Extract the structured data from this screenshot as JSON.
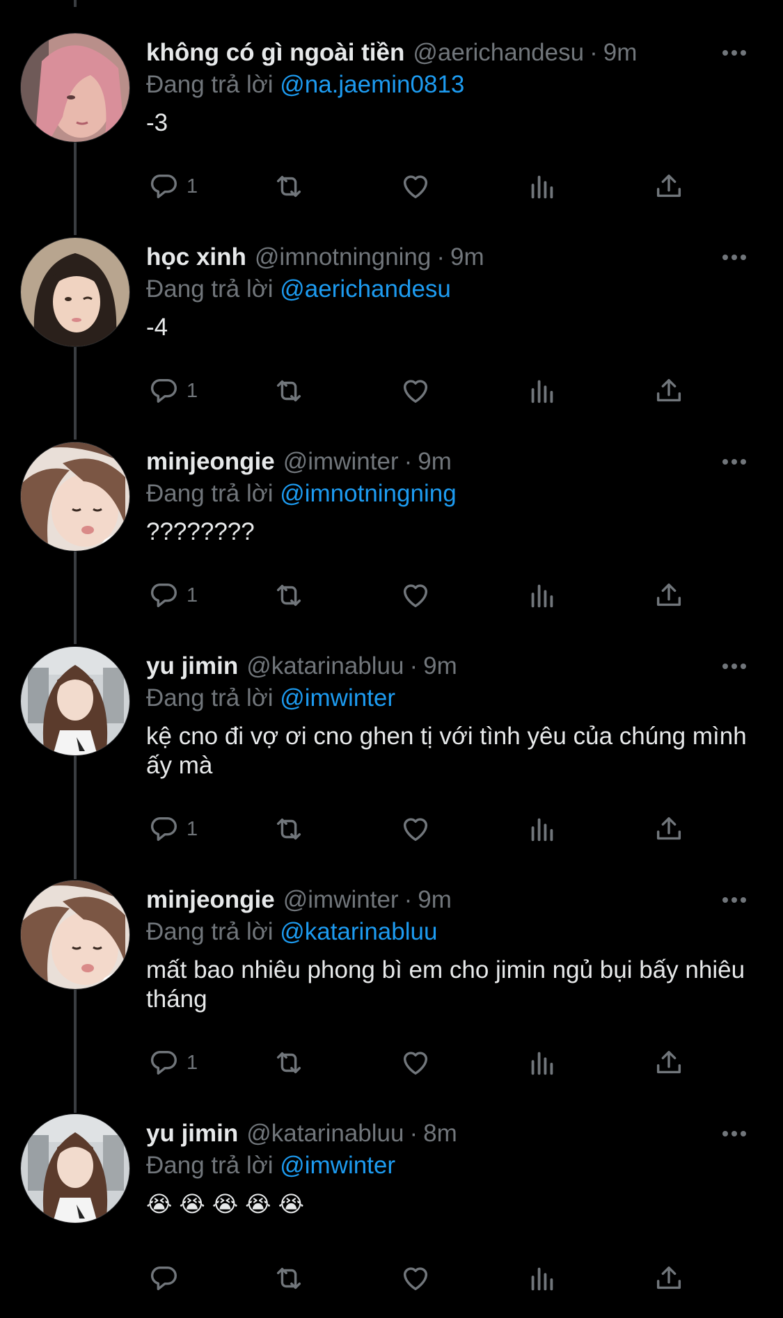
{
  "tweets": [
    {
      "name": "không có gì ngoài tiền",
      "handle": "@aerichandesu",
      "time": "9m",
      "reply_prefix": "Đang trả lời",
      "reply_to": "@na.jaemin0813",
      "text": "-3",
      "reply_count": "1",
      "avatar_icon": "avatar-pink-hair"
    },
    {
      "name": "học xinh",
      "handle": "@imnotningning",
      "time": "9m",
      "reply_prefix": "Đang trả lời",
      "reply_to": "@aerichandesu",
      "text": "-4",
      "reply_count": "1",
      "avatar_icon": "avatar-dark-hair"
    },
    {
      "name": "minjeongie",
      "handle": "@imwinter",
      "time": "9m",
      "reply_prefix": "Đang trả lời",
      "reply_to": "@imnotningning",
      "text": "????????",
      "reply_count": "1",
      "avatar_icon": "avatar-brown-hair"
    },
    {
      "name": "yu jimin",
      "handle": "@katarinabluu",
      "time": "9m",
      "reply_prefix": "Đang trả lời",
      "reply_to": "@imwinter",
      "text": "kệ cno đi vợ ơi cno ghen tị với tình yêu của chúng mình ấy mà",
      "reply_count": "1",
      "avatar_icon": "avatar-long-hair-outdoor"
    },
    {
      "name": "minjeongie",
      "handle": "@imwinter",
      "time": "9m",
      "reply_prefix": "Đang trả lời",
      "reply_to": "@katarinabluu",
      "text": "mất bao nhiêu phong bì em cho jimin ngủ bụi bấy nhiêu tháng",
      "reply_count": "1",
      "avatar_icon": "avatar-brown-hair"
    },
    {
      "name": "yu jimin",
      "handle": "@katarinabluu",
      "time": "8m",
      "reply_prefix": "Đang trả lời",
      "reply_to": "@imwinter",
      "emoji": [
        "😭",
        "😭",
        "😭",
        "😭",
        "😭"
      ],
      "reply_count": "",
      "avatar_icon": "avatar-long-hair-outdoor"
    }
  ],
  "icons": {
    "reply": "reply-icon",
    "retweet": "retweet-icon",
    "like": "like-icon",
    "views": "views-icon",
    "share": "share-icon",
    "more": "more-icon"
  },
  "colors": {
    "background": "#000000",
    "text_primary": "#e7e9ea",
    "text_secondary": "#71767b",
    "mention": "#1d9bf0",
    "thread_line": "#3a3d41"
  }
}
